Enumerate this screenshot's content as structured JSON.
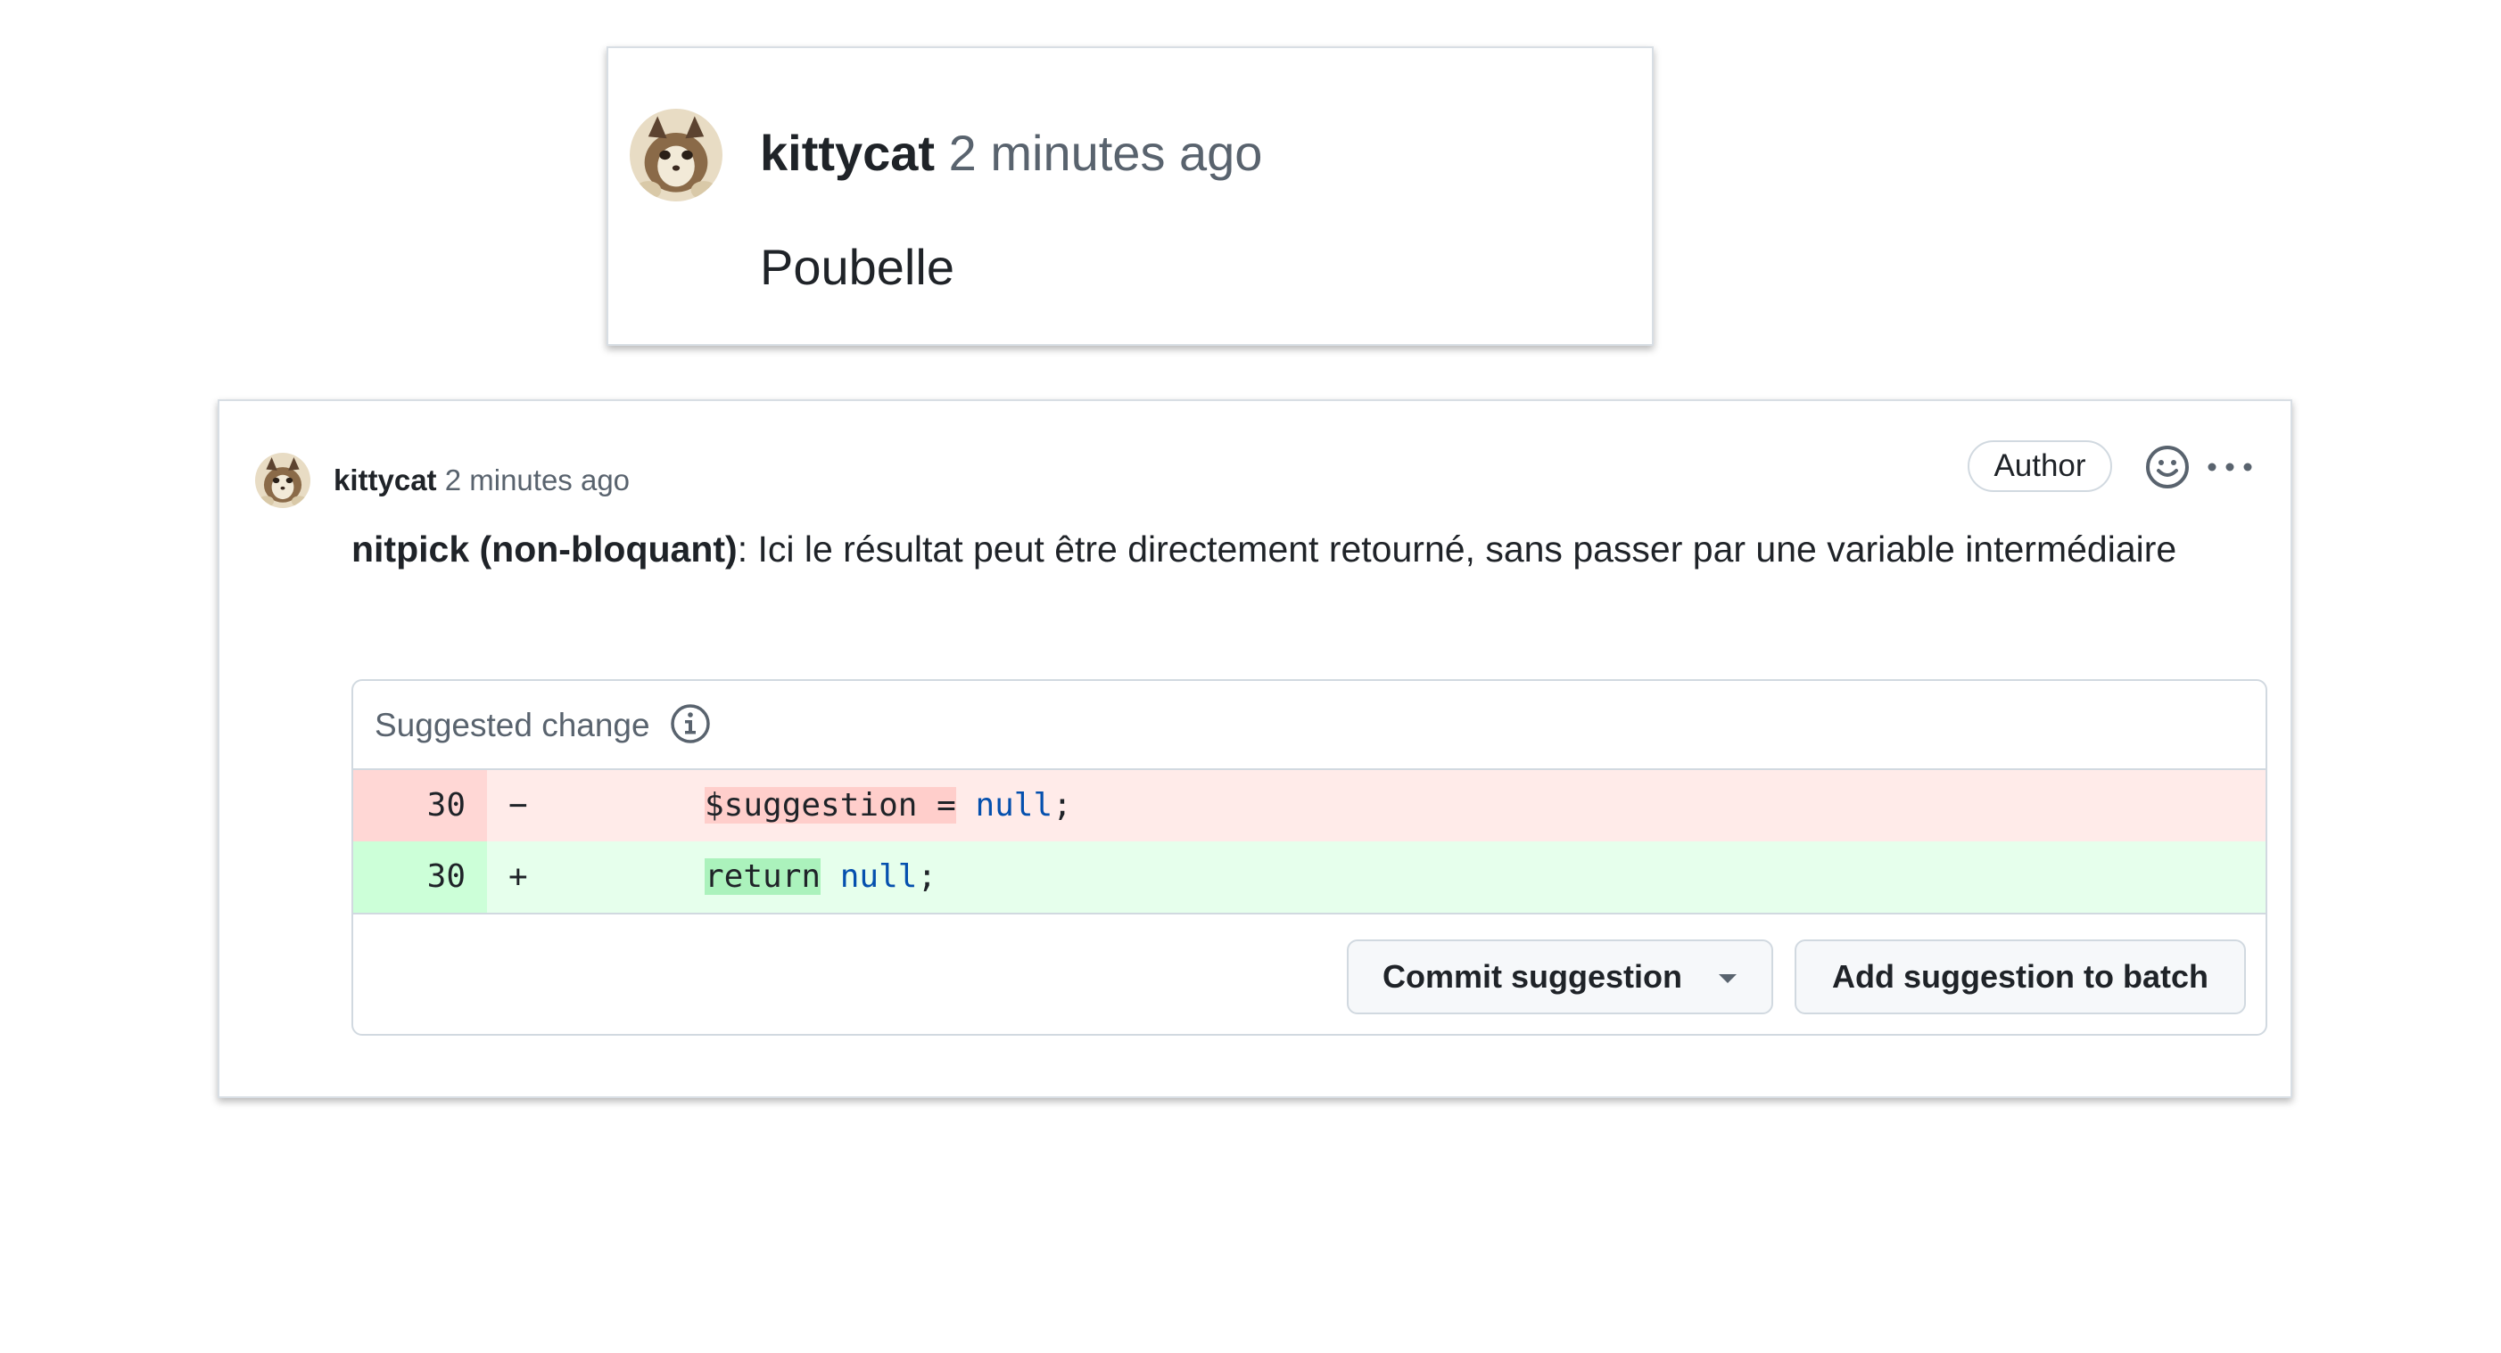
{
  "small_comment": {
    "author": "kittycat",
    "time": "2 minutes ago",
    "body": "Poubelle"
  },
  "review_comment": {
    "author": "kittycat",
    "time": "2 minutes ago",
    "author_badge": "Author",
    "body_strong": "nitpick (non-bloquant)",
    "body_rest": ": Ici le résultat peut être directement retourné, sans passer par une variable intermédiaire",
    "suggestion": {
      "title": "Suggested change",
      "deleted_line": {
        "number": "30",
        "sign": "−",
        "indent": "        ",
        "highlight": "$suggestion =",
        "keyword": "null",
        "tail": ";"
      },
      "added_line": {
        "number": "30",
        "sign": "+",
        "indent": "        ",
        "highlight": "return",
        "keyword": "null",
        "tail": ";"
      },
      "commit_button": "Commit suggestion",
      "batch_button": "Add suggestion to batch"
    }
  },
  "icons": {
    "avatar": "cat-avatar",
    "reaction": "smiley-icon",
    "menu": "kebab-horizontal-icon",
    "info": "info-icon",
    "caret": "triangle-down-icon"
  },
  "colors": {
    "deleted_bg": "#ffebe9",
    "deleted_highlight": "#ffcecb",
    "added_bg": "#e6ffec",
    "added_highlight": "#abf2bc",
    "keyword": "#0550ae",
    "muted_text": "#59636e"
  }
}
